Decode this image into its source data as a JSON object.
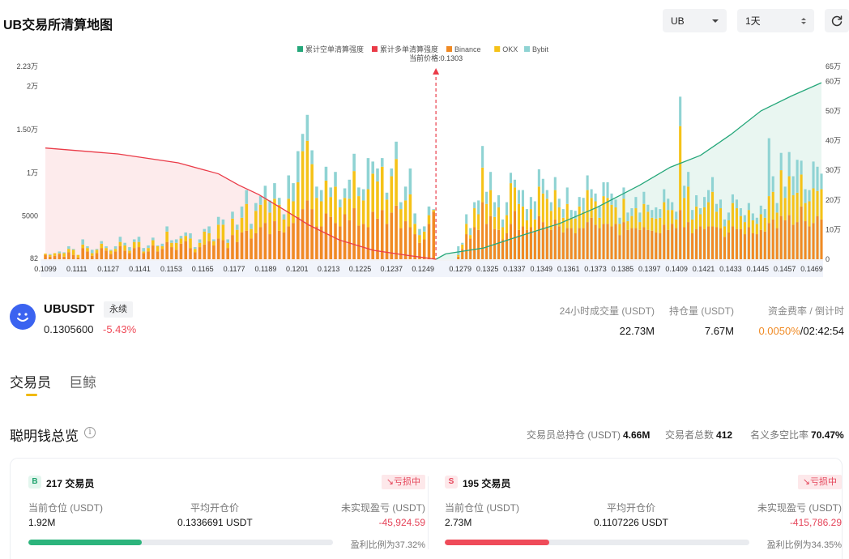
{
  "header": {
    "title": "UB交易所清算地图",
    "coin_select": "UB",
    "range_select": "1天"
  },
  "colors": {
    "binance": "#f08a24",
    "okx": "#f5c218",
    "bybit": "#8fd3d3",
    "cum_short": "#25a77a",
    "cum_long": "#ea3b48",
    "positive": "#2cb47c",
    "negative": "#ef4b59"
  },
  "chart_data": {
    "type": "bar",
    "legend": [
      "累计空单清算强度",
      "累计多单清算强度",
      "Binance",
      "OKX",
      "Bybit"
    ],
    "current_price_label": "当前价格:0.1303",
    "current_price": 0.1303,
    "x_tick_labels": [
      "0.1099",
      "0.1111",
      "0.1127",
      "0.1141",
      "0.1153",
      "0.1165",
      "0.1177",
      "0.1189",
      "0.1201",
      "0.1213",
      "0.1225",
      "0.1237",
      "0.1249",
      "0.1279",
      "0.1325",
      "0.1337",
      "0.1349",
      "0.1361",
      "0.1373",
      "0.1385",
      "0.1397",
      "0.1409",
      "0.1421",
      "0.1433",
      "0.1445",
      "0.1457",
      "0.1469"
    ],
    "left_axis": {
      "ticks": [
        "82",
        "5000",
        "1万",
        "1.50万",
        "2万",
        "2.23万"
      ],
      "range": [
        82,
        22300
      ]
    },
    "right_axis": {
      "ticks": [
        "0",
        "10万",
        "20万",
        "30万",
        "40万",
        "50万",
        "60万",
        "65万"
      ],
      "range": [
        0,
        650000
      ]
    },
    "bars": {
      "left_prices": [
        0.1099,
        0.1111
      ],
      "right_prices": [
        0.1325,
        0.1469
      ],
      "left": [
        [
          500,
          150,
          0
        ],
        [
          300,
          200,
          100
        ],
        [
          400,
          300,
          0
        ],
        [
          600,
          100,
          200
        ],
        [
          300,
          400,
          100
        ],
        [
          800,
          400,
          300
        ],
        [
          500,
          600,
          100
        ],
        [
          200,
          300,
          0
        ],
        [
          1300,
          400,
          600
        ],
        [
          900,
          400,
          200
        ],
        [
          400,
          300,
          400
        ],
        [
          700,
          400,
          100
        ],
        [
          1300,
          500,
          300
        ],
        [
          1000,
          300,
          200
        ],
        [
          600,
          400,
          100
        ],
        [
          900,
          300,
          300
        ],
        [
          1500,
          500,
          600
        ],
        [
          1000,
          600,
          300
        ],
        [
          700,
          300,
          400
        ],
        [
          1300,
          700,
          300
        ],
        [
          1400,
          600,
          600
        ],
        [
          700,
          200,
          400
        ],
        [
          900,
          400,
          300
        ],
        [
          1600,
          600,
          300
        ],
        [
          900,
          600,
          100
        ],
        [
          1200,
          300,
          300
        ],
        [
          2000,
          1200,
          600
        ],
        [
          1400,
          500,
          300
        ],
        [
          1100,
          800,
          400
        ],
        [
          1800,
          600,
          300
        ],
        [
          2100,
          600,
          400
        ],
        [
          1300,
          1100,
          600
        ],
        [
          800,
          400,
          200
        ],
        [
          1400,
          500,
          400
        ],
        [
          1700,
          1500,
          300
        ],
        [
          2100,
          900,
          800
        ],
        [
          1600,
          500,
          200
        ],
        [
          2400,
          1600,
          900
        ],
        [
          2200,
          1800,
          600
        ],
        [
          1300,
          600,
          400
        ],
        [
          2800,
          1900,
          800
        ],
        [
          2000,
          1400,
          600
        ],
        [
          3100,
          1700,
          1300
        ],
        [
          3300,
          3100,
          1600
        ],
        [
          2400,
          1100,
          600
        ],
        [
          3000,
          2600,
          900
        ],
        [
          3700,
          2600,
          1000
        ],
        [
          4200,
          2700,
          1600
        ],
        [
          2900,
          2500,
          1400
        ],
        [
          4400,
          2600,
          1800
        ],
        [
          3300,
          3000,
          800
        ],
        [
          3100,
          1500,
          600
        ],
        [
          3800,
          3200,
          2700
        ],
        [
          4200,
          2500,
          2100
        ],
        [
          4900,
          4000,
          3600
        ],
        [
          5800,
          6700,
          2000
        ],
        [
          6800,
          6900,
          3000
        ],
        [
          5800,
          5200,
          1600
        ],
        [
          3800,
          3300,
          1300
        ],
        [
          3800,
          2900,
          1300
        ],
        [
          5300,
          3800,
          1600
        ],
        [
          4900,
          2300,
          1100
        ],
        [
          4200,
          4200,
          1700
        ],
        [
          3800,
          2200,
          900
        ],
        [
          5200,
          1900,
          1100
        ],
        [
          4500,
          2500,
          2200
        ],
        [
          5900,
          4300,
          2000
        ],
        [
          3900,
          3400,
          1000
        ],
        [
          4100,
          2700,
          1300
        ],
        [
          3700,
          4400,
          3600
        ],
        [
          5500,
          4400,
          1400
        ],
        [
          4700,
          4300,
          1500
        ],
        [
          5700,
          5000,
          1000
        ],
        [
          4100,
          2800,
          800
        ],
        [
          5400,
          4200,
          900
        ],
        [
          6200,
          5400,
          2000
        ],
        [
          3600,
          2200,
          800
        ],
        [
          4400,
          2400,
          1600
        ],
        [
          3700,
          3800,
          3000
        ],
        [
          2900,
          1200,
          1200
        ],
        [
          1900,
          900,
          700
        ],
        [
          2300,
          900,
          600
        ],
        [
          4100,
          1000,
          1000
        ],
        [
          5500,
          200,
          100
        ]
      ],
      "right": [
        [
          300,
          200,
          1000
        ],
        [
          1200,
          500,
          200
        ],
        [
          2900,
          1200,
          1100
        ],
        [
          2400,
          400,
          800
        ],
        [
          3700,
          2200,
          700
        ],
        [
          3400,
          1800,
          1600
        ],
        [
          6600,
          4000,
          2500
        ],
        [
          4100,
          2300,
          1400
        ],
        [
          5000,
          3000,
          2100
        ],
        [
          3500,
          1400,
          1700
        ],
        [
          3400,
          2600,
          1400
        ],
        [
          2300,
          1400,
          900
        ],
        [
          3000,
          2100,
          1500
        ],
        [
          4100,
          4700,
          1200
        ],
        [
          5600,
          2700,
          900
        ],
        [
          3400,
          3000,
          1600
        ],
        [
          3800,
          2300,
          1900
        ],
        [
          3400,
          1100,
          1300
        ],
        [
          3700,
          2100,
          1400
        ],
        [
          3300,
          1300,
          2100
        ],
        [
          5000,
          3400,
          2000
        ],
        [
          4300,
          3300,
          1700
        ],
        [
          3800,
          3200,
          1000
        ],
        [
          3400,
          2200,
          1000
        ],
        [
          4600,
          3400,
          1500
        ],
        [
          3800,
          2200,
          1000
        ],
        [
          3100,
          1700,
          1000
        ],
        [
          3600,
          2800,
          1900
        ],
        [
          3600,
          1200,
          900
        ],
        [
          3000,
          1700,
          900
        ],
        [
          3600,
          2500,
          1100
        ],
        [
          3600,
          1900,
          1600
        ],
        [
          4300,
          3700,
          1700
        ],
        [
          4800,
          2300,
          1000
        ],
        [
          4000,
          2700,
          900
        ],
        [
          3600,
          1200,
          1300
        ],
        [
          4100,
          3200,
          1600
        ],
        [
          4100,
          3000,
          1800
        ],
        [
          3800,
          2500,
          1300
        ],
        [
          4100,
          1900,
          900
        ],
        [
          2800,
          1300,
          700
        ],
        [
          4300,
          2700,
          1300
        ],
        [
          3400,
          1000,
          1000
        ],
        [
          3600,
          1400,
          900
        ],
        [
          3600,
          2300,
          1300
        ],
        [
          3400,
          900,
          1100
        ],
        [
          3700,
          2700,
          1400
        ],
        [
          3400,
          2100,
          800
        ],
        [
          3300,
          1500,
          900
        ],
        [
          3100,
          1600,
          1300
        ],
        [
          3000,
          1800,
          1000
        ],
        [
          4000,
          2600,
          1500
        ],
        [
          3400,
          2300,
          1300
        ],
        [
          4100,
          1600,
          900
        ],
        [
          3600,
          1000,
          900
        ],
        [
          5700,
          9700,
          3400
        ],
        [
          3700,
          3400,
          1400
        ],
        [
          4300,
          4100,
          1700
        ],
        [
          3000,
          1600,
          1100
        ],
        [
          3500,
          2600,
          1300
        ],
        [
          3800,
          1400,
          700
        ],
        [
          3500,
          2500,
          1200
        ],
        [
          3800,
          2800,
          1400
        ],
        [
          3800,
          4000,
          1700
        ],
        [
          3700,
          1800,
          900
        ],
        [
          3600,
          2300,
          1000
        ],
        [
          2600,
          1200,
          800
        ],
        [
          3100,
          1400,
          900
        ],
        [
          3800,
          2700,
          1000
        ],
        [
          3500,
          2400,
          1000
        ],
        [
          3500,
          1500,
          900
        ],
        [
          2900,
          1400,
          800
        ],
        [
          3700,
          2000,
          800
        ],
        [
          3000,
          1500,
          800
        ],
        [
          2900,
          1200,
          700
        ],
        [
          3400,
          1800,
          1000
        ],
        [
          3200,
          1600,
          1000
        ],
        [
          4200,
          3100,
          6700
        ],
        [
          4600,
          3200,
          1800
        ],
        [
          3600,
          1800,
          1100
        ],
        [
          5000,
          5300,
          2000
        ],
        [
          4500,
          2600,
          1300
        ],
        [
          5100,
          4500,
          2800
        ],
        [
          4000,
          3400,
          2200
        ],
        [
          4300,
          3400,
          3800
        ],
        [
          6100,
          3700,
          1600
        ],
        [
          4400,
          2100,
          1600
        ],
        [
          3800,
          2900,
          1300
        ],
        [
          4200,
          4000,
          3100
        ],
        [
          5000,
          2900,
          2800
        ],
        [
          4600,
          3500,
          1800
        ]
      ]
    },
    "cum_long_curve": [
      [
        0.1099,
        37.5
      ],
      [
        0.1135,
        35.5
      ],
      [
        0.1165,
        32.5
      ],
      [
        0.1185,
        28.8
      ],
      [
        0.1195,
        25.0
      ],
      [
        0.1205,
        21.8
      ],
      [
        0.1218,
        16.5
      ],
      [
        0.123,
        11.5
      ],
      [
        0.1245,
        6.5
      ],
      [
        0.1262,
        3.0
      ],
      [
        0.128,
        1.2
      ],
      [
        0.1303,
        0.0
      ]
    ],
    "cum_short_curve": [
      [
        0.1303,
        0.0
      ],
      [
        0.132,
        1.8
      ],
      [
        0.1335,
        3.8
      ],
      [
        0.135,
        8.0
      ],
      [
        0.1365,
        12.0
      ],
      [
        0.138,
        17.5
      ],
      [
        0.1397,
        25.0
      ],
      [
        0.1409,
        31.0
      ],
      [
        0.1421,
        35.0
      ],
      [
        0.1433,
        42.0
      ],
      [
        0.1445,
        50.0
      ],
      [
        0.1457,
        55.0
      ],
      [
        0.1469,
        59.5
      ]
    ]
  },
  "ticker": {
    "symbol": "UBUSDT",
    "tag": "永续",
    "price": "0.1305600",
    "change": "-5.43%",
    "volume_label": "24小时成交量 (USDT)",
    "volume_value": "22.73M",
    "oi_label": "持仓量 (USDT)",
    "oi_value": "7.67M",
    "funding_label": "资金费率 / 倒计时",
    "funding_rate": "0.0050%",
    "funding_countdown": "/02:42:54"
  },
  "tabs": [
    "交易员",
    "巨鲸"
  ],
  "smart_money": {
    "title": "聪明钱总览",
    "total_position_label": "交易员总持仓 (USDT)",
    "total_position_value": "4.66M",
    "trader_count_label": "交易者总数",
    "trader_count_value": "412",
    "ratio_label": "名义多空比率",
    "ratio_value": "70.47%",
    "long": {
      "badge": "B",
      "count_label": "217 交易员",
      "status": "↘亏损中",
      "position_label": "当前仓位 (USDT)",
      "position_value": "1.92M",
      "avg_price_label": "平均开仓价",
      "avg_price_value": "0.1336691 USDT",
      "pnl_label": "未实现盈亏 (USDT)",
      "pnl_value": "-45,924.59",
      "win_rate_label": "盈利比例为37.32%",
      "win_rate": 0.3732
    },
    "short": {
      "badge": "S",
      "count_label": "195 交易员",
      "status": "↘亏损中",
      "position_label": "当前仓位 (USDT)",
      "position_value": "2.73M",
      "avg_price_label": "平均开仓价",
      "avg_price_value": "0.1107226 USDT",
      "pnl_label": "未实现盈亏 (USDT)",
      "pnl_value": "-415,786.29",
      "win_rate_label": "盈利比例为34.35%",
      "win_rate": 0.3435
    }
  }
}
